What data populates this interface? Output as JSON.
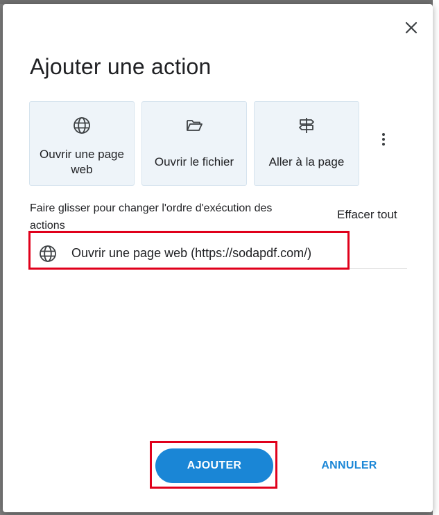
{
  "dialog": {
    "title": "Ajouter une action",
    "close_icon": "close-icon",
    "tiles": [
      {
        "label": "Ouvrir une page web",
        "icon": "globe-icon"
      },
      {
        "label": "Ouvrir le fichier",
        "icon": "folder-open-icon"
      },
      {
        "label": "Aller à la page",
        "icon": "signpost-icon"
      }
    ],
    "more_icon": "more-vertical-icon",
    "reorder_hint": "Faire glisser pour changer l'ordre d'exécution des actions",
    "clear_all_label": "Effacer tout",
    "actions": [
      {
        "label": "Ouvrir une page web (https://sodapdf.com/)",
        "icon": "globe-icon"
      }
    ],
    "add_label": "AJOUTER",
    "cancel_label": "ANNULER"
  },
  "colors": {
    "accent": "#1a86d6",
    "highlight": "#e0001b",
    "tile_bg": "#eef4f9",
    "backdrop": "#7d7d7d"
  }
}
